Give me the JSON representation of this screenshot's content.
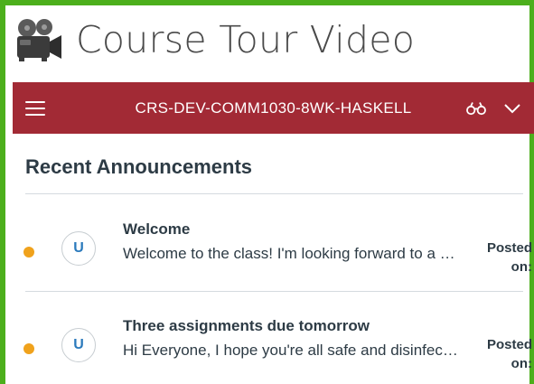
{
  "page": {
    "title": "Course Tour Video",
    "icon": "movie-camera-icon"
  },
  "nav": {
    "course_name": "CRS-DEV-COMM1030-8WK-HASKELL",
    "menu_icon": "hamburger-menu-icon",
    "glasses_icon": "glasses-icon",
    "dropdown_icon": "chevron-down-icon",
    "background_color": "#a22a35"
  },
  "announcements": {
    "heading": "Recent Announcements",
    "posted_label_line1": "Posted",
    "posted_label_line2": "on:",
    "items": [
      {
        "avatar_initial": "U",
        "title": "Welcome",
        "body": "Welcome to the class! I'm looking forward to a great term with you all.",
        "unread_color": "#f0a21c"
      },
      {
        "avatar_initial": "U",
        "title": "Three assignments due tomorrow",
        "body": "Hi Everyone, I hope you're all safe and disinfected.",
        "unread_color": "#f0a21c"
      }
    ]
  }
}
